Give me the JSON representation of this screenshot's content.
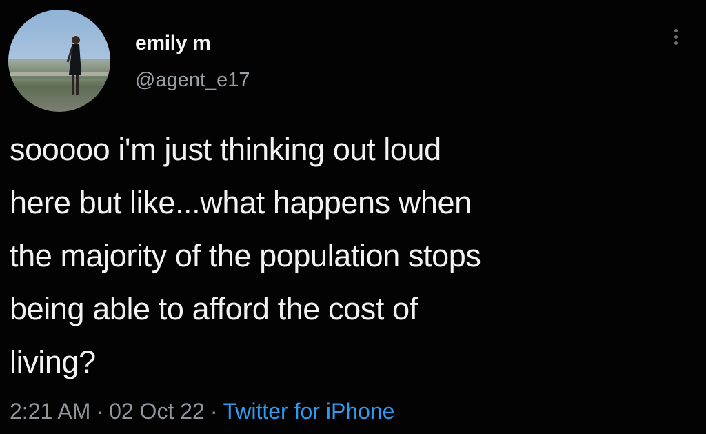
{
  "tweet": {
    "avatar_icon": "profile-photo",
    "display_name": "emily m",
    "handle": "@agent_e17",
    "more_icon": "vertical-ellipsis-icon",
    "text": "sooooo i'm just thinking out loud\nhere but like...what happens when\nthe majority of the population stops\nbeing able to afford the cost of\nliving?",
    "time": "2:21 AM",
    "separator": "·",
    "date": "02 Oct 22",
    "source": "Twitter for iPhone"
  },
  "colors": {
    "background": "#030303",
    "text": "#f2f2f2",
    "muted": "#8f959a",
    "link": "#2f9bf0"
  }
}
